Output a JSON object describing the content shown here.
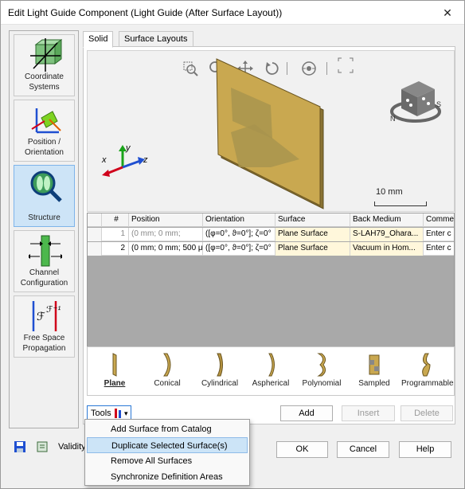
{
  "window": {
    "title": "Edit Light Guide Component (Light Guide (After Surface Layout))",
    "close": "✕"
  },
  "sidebar": {
    "items": [
      {
        "label1": "Coordinate",
        "label2": "Systems"
      },
      {
        "label1": "Position /",
        "label2": "Orientation"
      },
      {
        "label1": "",
        "label2": "Structure"
      },
      {
        "label1": "Channel",
        "label2": "Configuration"
      },
      {
        "label1": "Free Space",
        "label2": "Propagation"
      }
    ]
  },
  "tabs": [
    "Solid",
    "Surface Layouts"
  ],
  "view": {
    "scale_label": "10 mm",
    "axis_x": "x",
    "axis_y": "y",
    "axis_z": "z",
    "cube_letters": [
      "N",
      "S"
    ]
  },
  "grid": {
    "headers": [
      "#",
      "Position",
      "Orientation",
      "Surface",
      "Back Medium",
      "Comme"
    ],
    "rows": [
      [
        "1",
        "(0 mm; 0 mm;",
        "([φ=0°, ϑ=0°]; ζ=0°",
        "Plane Surface",
        "S-LAH79_Ohara...",
        "Enter c"
      ],
      [
        "2",
        "(0 mm; 0 mm; 500 μ",
        "([φ=0°, ϑ=0°]; ζ=0°",
        "Plane Surface",
        "Vacuum in Hom...",
        "Enter c"
      ]
    ]
  },
  "surface_types": [
    "Plane",
    "Conical",
    "Cylindrical",
    "Aspherical",
    "Polynomial",
    "Sampled",
    "Programmable"
  ],
  "buttons": {
    "tools": "Tools",
    "add": "Add",
    "insert": "Insert",
    "delete": "Delete",
    "ok": "OK",
    "cancel": "Cancel",
    "help": "Help",
    "validity": "Validity"
  },
  "menu": [
    "Add Surface from Catalog",
    "Duplicate Selected Surface(s)",
    "Remove All Surfaces",
    "Synchronize Definition Areas"
  ],
  "colors": {
    "plate": "#c9a850",
    "selection": "#cde4f7",
    "accent": "#2b79d6"
  }
}
